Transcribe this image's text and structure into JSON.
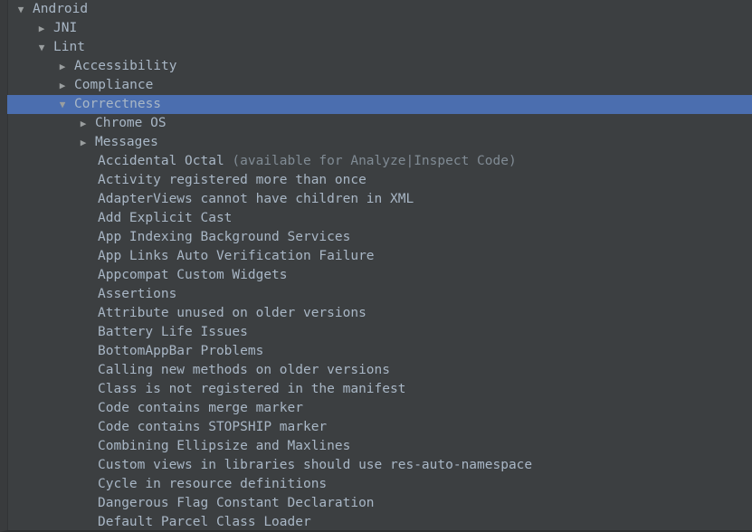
{
  "panel": {
    "name": "inspections-tree",
    "background_color": "#3c3f41",
    "selection_color": "#4b6eaf",
    "text_color": "#a9b7c6",
    "dim_text_color": "#808b94"
  },
  "tree": {
    "rows": [
      {
        "label": "Android",
        "level": 0,
        "twisty": "expanded",
        "selected": false
      },
      {
        "label": "JNI",
        "level": 1,
        "twisty": "collapsed",
        "selected": false
      },
      {
        "label": "Lint",
        "level": 1,
        "twisty": "expanded",
        "selected": false
      },
      {
        "label": "Accessibility",
        "level": 2,
        "twisty": "collapsed",
        "selected": false
      },
      {
        "label": "Compliance",
        "level": 2,
        "twisty": "collapsed",
        "selected": false
      },
      {
        "label": "Correctness",
        "level": 2,
        "twisty": "expanded",
        "selected": true
      },
      {
        "label": "Chrome OS",
        "level": 3,
        "twisty": "collapsed",
        "selected": false
      },
      {
        "label": "Messages",
        "level": 3,
        "twisty": "collapsed",
        "selected": false
      },
      {
        "label": "Accidental Octal ",
        "dim": "(available for Analyze|Inspect Code)",
        "level": 4,
        "twisty": "none",
        "selected": false
      },
      {
        "label": "Activity registered more than once",
        "level": 4,
        "twisty": "none",
        "selected": false
      },
      {
        "label": "AdapterViews cannot have children in XML",
        "level": 4,
        "twisty": "none",
        "selected": false
      },
      {
        "label": "Add Explicit Cast",
        "level": 4,
        "twisty": "none",
        "selected": false
      },
      {
        "label": "App Indexing Background Services",
        "level": 4,
        "twisty": "none",
        "selected": false
      },
      {
        "label": "App Links Auto Verification Failure",
        "level": 4,
        "twisty": "none",
        "selected": false
      },
      {
        "label": "Appcompat Custom Widgets",
        "level": 4,
        "twisty": "none",
        "selected": false
      },
      {
        "label": "Assertions",
        "level": 4,
        "twisty": "none",
        "selected": false
      },
      {
        "label": "Attribute unused on older versions",
        "level": 4,
        "twisty": "none",
        "selected": false
      },
      {
        "label": "Battery Life Issues",
        "level": 4,
        "twisty": "none",
        "selected": false
      },
      {
        "label": "BottomAppBar Problems",
        "level": 4,
        "twisty": "none",
        "selected": false
      },
      {
        "label": "Calling new methods on older versions",
        "level": 4,
        "twisty": "none",
        "selected": false
      },
      {
        "label": "Class is not registered in the manifest",
        "level": 4,
        "twisty": "none",
        "selected": false
      },
      {
        "label": "Code contains merge marker",
        "level": 4,
        "twisty": "none",
        "selected": false
      },
      {
        "label": "Code contains STOPSHIP marker",
        "level": 4,
        "twisty": "none",
        "selected": false
      },
      {
        "label": "Combining Ellipsize and Maxlines",
        "level": 4,
        "twisty": "none",
        "selected": false
      },
      {
        "label": "Custom views in libraries should use res-auto-namespace",
        "level": 4,
        "twisty": "none",
        "selected": false
      },
      {
        "label": "Cycle in resource definitions",
        "level": 4,
        "twisty": "none",
        "selected": false
      },
      {
        "label": "Dangerous Flag Constant Declaration",
        "level": 4,
        "twisty": "none",
        "selected": false
      },
      {
        "label": "Default Parcel Class Loader",
        "level": 4,
        "twisty": "none",
        "selected": false
      }
    ]
  }
}
